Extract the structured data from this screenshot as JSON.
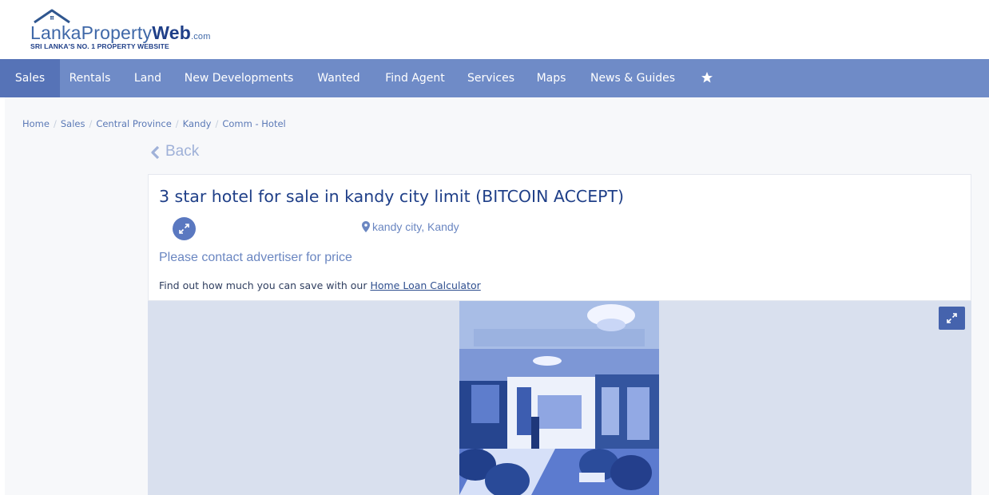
{
  "logo": {
    "word_1": "Lanka",
    "word_2": "Property",
    "word_3": "Web",
    "domain": ".com",
    "tagline": "SRI LANKA'S NO. 1 PROPERTY WEBSITE"
  },
  "nav": {
    "items": [
      {
        "label": "Sales",
        "active": true
      },
      {
        "label": "Rentals"
      },
      {
        "label": "Land"
      },
      {
        "label": "New Developments"
      },
      {
        "label": "Wanted"
      },
      {
        "label": "Find Agent"
      },
      {
        "label": "Services"
      },
      {
        "label": "Maps"
      },
      {
        "label": "News & Guides"
      }
    ],
    "star_icon": "star-icon"
  },
  "breadcrumb": {
    "items": [
      "Home",
      "Sales",
      "Central Province",
      "Kandy",
      "Comm - Hotel"
    ],
    "separator": "/"
  },
  "back": {
    "label": "Back",
    "icon": "chevron-left-icon"
  },
  "listing": {
    "title": "3 star hotel for sale in kandy city limit (BITCOIN ACCEPT)",
    "location": "kandy city, Kandy",
    "price_note": "Please contact advertiser for price",
    "loan_text": "Find out how much you can save with our ",
    "loan_link": "Home Loan Calculator"
  },
  "colors": {
    "nav_bg": "#6f8bc7",
    "nav_active": "#5673b7",
    "title": "#1f3f88",
    "accent": "#5a78c0",
    "gallery_bg": "#d9e0ee"
  }
}
